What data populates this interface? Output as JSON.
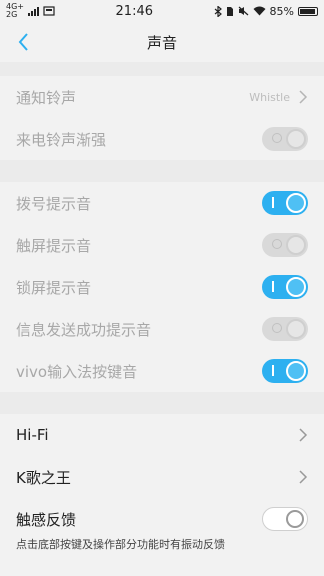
{
  "status": {
    "carrier_top": "4G+",
    "carrier_bottom": "2G",
    "time": "21:46",
    "battery": "85%"
  },
  "header": {
    "title": "声音"
  },
  "group1": {
    "ringtone": {
      "label": "通知铃声",
      "value": "Whistle"
    },
    "ramp": {
      "label": "来电铃声渐强",
      "state": "off"
    }
  },
  "group2": {
    "items": [
      {
        "label": "拨号提示音",
        "state": "on"
      },
      {
        "label": "触屏提示音",
        "state": "off"
      },
      {
        "label": "锁屏提示音",
        "state": "on"
      },
      {
        "label": "信息发送成功提示音",
        "state": "off"
      },
      {
        "label": "vivo输入法按键音",
        "state": "on"
      }
    ]
  },
  "group3": {
    "hifi": {
      "label": "Hi-Fi"
    },
    "karaoke": {
      "label": "K歌之王"
    },
    "haptic": {
      "label": "触感反馈",
      "state": "off",
      "note": "点击底部按键及操作部分功能时有振动反馈"
    }
  },
  "colors": {
    "accent": "#2db0f0"
  }
}
